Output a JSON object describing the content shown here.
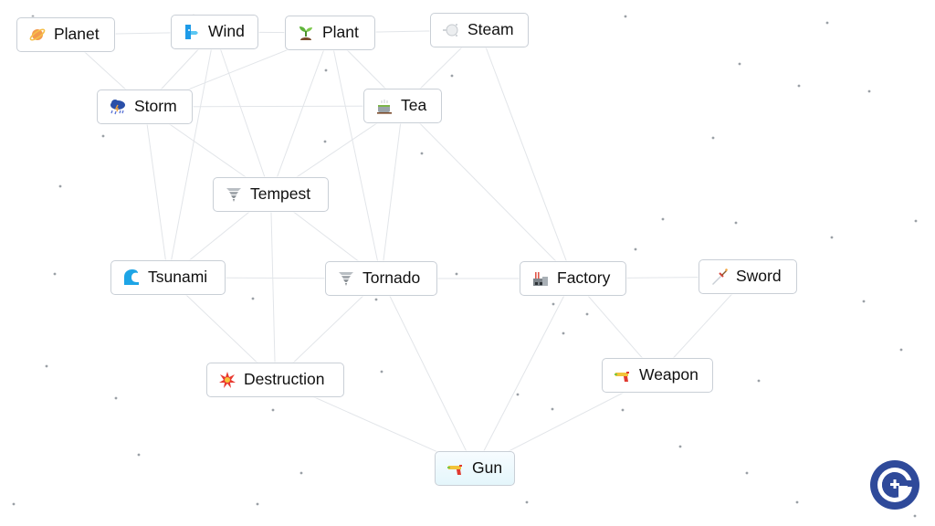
{
  "app": "Infinite Craft",
  "nodes": [
    {
      "id": "planet",
      "label": "Planet",
      "icon": "ringed-planet-icon"
    },
    {
      "id": "wind",
      "label": "Wind",
      "icon": "wind-face-icon"
    },
    {
      "id": "plant",
      "label": "Plant",
      "icon": "seedling-icon"
    },
    {
      "id": "steam",
      "label": "Steam",
      "icon": "steam-cloud-icon"
    },
    {
      "id": "storm",
      "label": "Storm",
      "icon": "cloud-lightning-rain-icon"
    },
    {
      "id": "tea",
      "label": "Tea",
      "icon": "teacup-icon"
    },
    {
      "id": "tempest",
      "label": "Tempest",
      "icon": "tornado-icon"
    },
    {
      "id": "tsunami",
      "label": "Tsunami",
      "icon": "water-wave-icon"
    },
    {
      "id": "tornado",
      "label": "Tornado",
      "icon": "tornado-icon"
    },
    {
      "id": "factory",
      "label": "Factory",
      "icon": "factory-icon"
    },
    {
      "id": "sword",
      "label": "Sword",
      "icon": "dagger-icon"
    },
    {
      "id": "destruction",
      "label": "Destruction",
      "icon": "collision-icon"
    },
    {
      "id": "weapon",
      "label": "Weapon",
      "icon": "water-pistol-icon"
    },
    {
      "id": "gun",
      "label": "Gun",
      "icon": "water-pistol-icon",
      "selected": true
    }
  ],
  "connections": [
    [
      "planet",
      "wind"
    ],
    [
      "planet",
      "storm"
    ],
    [
      "wind",
      "plant"
    ],
    [
      "plant",
      "steam"
    ],
    [
      "wind",
      "storm"
    ],
    [
      "plant",
      "storm"
    ],
    [
      "plant",
      "tea"
    ],
    [
      "steam",
      "tea"
    ],
    [
      "wind",
      "tempest"
    ],
    [
      "plant",
      "tempest"
    ],
    [
      "storm",
      "tempest"
    ],
    [
      "tea",
      "tempest"
    ],
    [
      "storm",
      "tea"
    ],
    [
      "storm",
      "tsunami"
    ],
    [
      "wind",
      "tsunami"
    ],
    [
      "tempest",
      "tsunami"
    ],
    [
      "tempest",
      "tornado"
    ],
    [
      "tea",
      "tornado"
    ],
    [
      "plant",
      "tornado"
    ],
    [
      "tsunami",
      "tornado"
    ],
    [
      "tea",
      "factory"
    ],
    [
      "steam",
      "factory"
    ],
    [
      "tornado",
      "factory"
    ],
    [
      "factory",
      "sword"
    ],
    [
      "tsunami",
      "destruction"
    ],
    [
      "tempest",
      "destruction"
    ],
    [
      "tornado",
      "destruction"
    ],
    [
      "factory",
      "weapon"
    ],
    [
      "sword",
      "weapon"
    ],
    [
      "destruction",
      "gun"
    ],
    [
      "tornado",
      "gun"
    ],
    [
      "factory",
      "gun"
    ],
    [
      "weapon",
      "gun"
    ]
  ],
  "brand": {
    "logo": "gamerant-logo-icon",
    "logo_color": "#2f4a9a"
  },
  "colors": {
    "edge": "#e2e5e9",
    "dot": "#9aa0a6",
    "border": "#c9cfd6"
  }
}
